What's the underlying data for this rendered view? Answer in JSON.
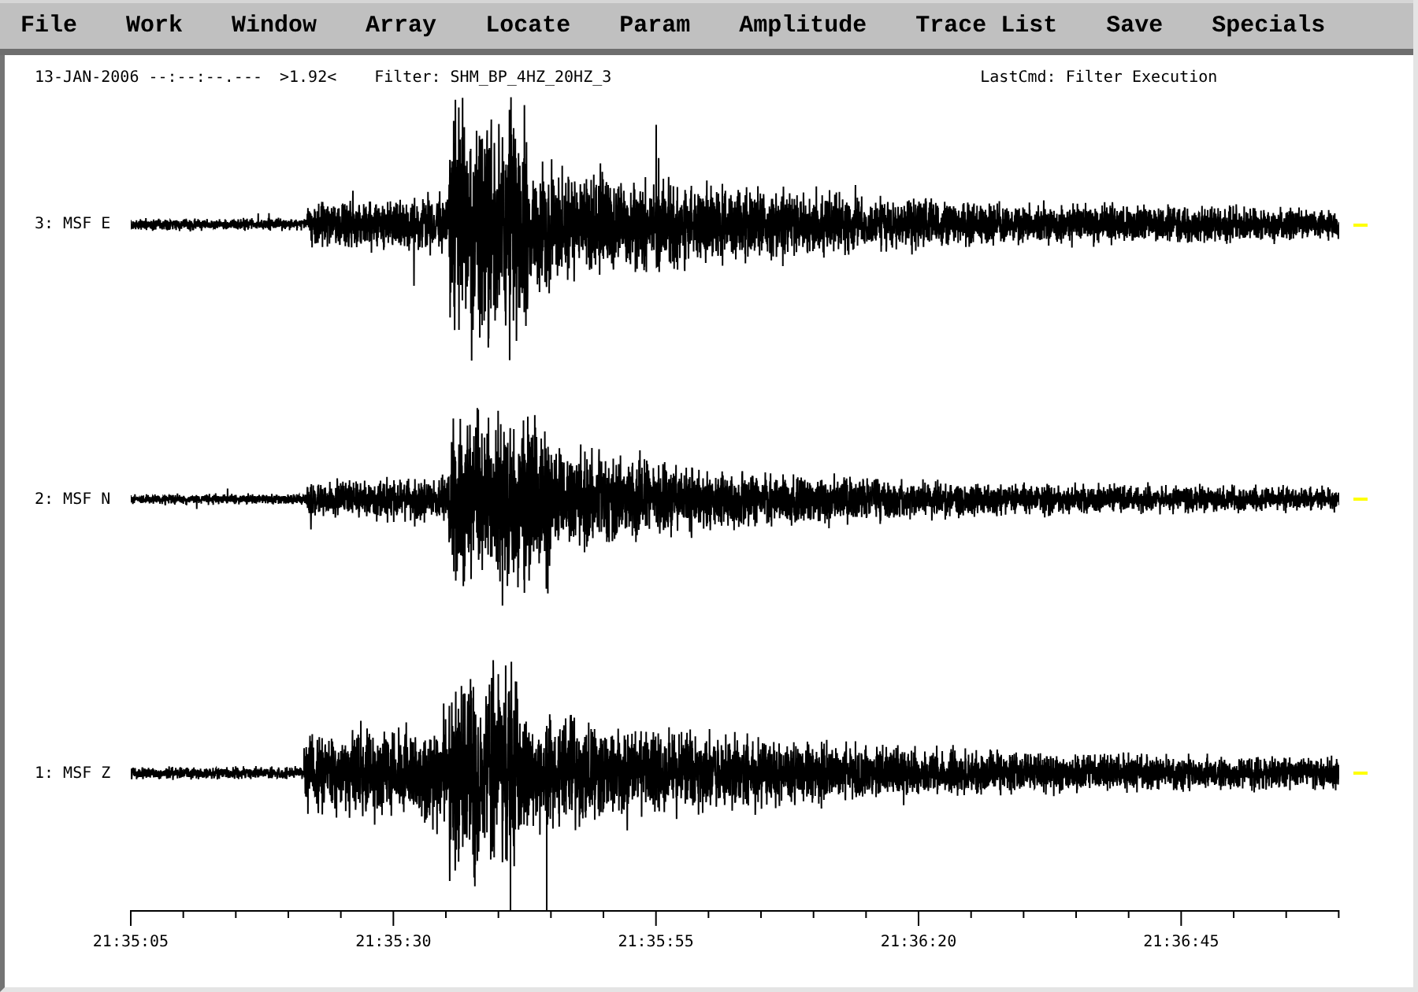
{
  "menu": [
    "File",
    "Work",
    "Window",
    "Array",
    "Locate",
    "Param",
    "Amplitude",
    "Trace List",
    "Save",
    "Specials"
  ],
  "header": {
    "date_time": "13-JAN-2006 --:--:--.---",
    "amplitude": ">1.92<",
    "filter": "Filter: SHM_BP_4HZ_20HZ_3",
    "last_command": "LastCmd: Filter Execution"
  },
  "traces": [
    {
      "label": "3: MSF E"
    },
    {
      "label": "2: MSF N"
    },
    {
      "label": "1: MSF Z"
    }
  ],
  "time_axis": {
    "labels": [
      "21:35:05",
      "21:35:30",
      "21:35:55",
      "21:36:20",
      "21:36:45"
    ]
  }
}
